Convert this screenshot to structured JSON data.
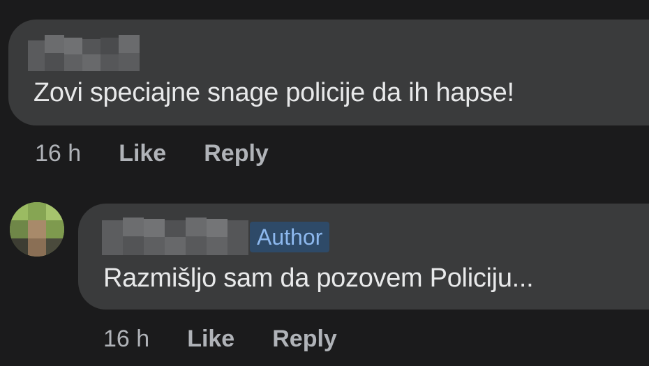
{
  "colors": {
    "background": "#1b1b1c",
    "bubble": "#3a3b3c",
    "text": "#e8e9ea",
    "meta": "#b0b3b8",
    "author_badge_bg": "#2e4a68",
    "author_badge_text": "#8db8ee"
  },
  "comment": {
    "author_name": "",
    "author_name_state": "pixelated",
    "text": "Zovi speciajne snage policije da ih hapse!",
    "timestamp": "16 h",
    "like_label": "Like",
    "reply_label": "Reply"
  },
  "reply": {
    "author_name": "",
    "author_name_state": "pixelated",
    "avatar_state": "pixelated",
    "badge": "Author",
    "text": "Razmišljo sam da pozovem Policiju...",
    "timestamp": "16 h",
    "like_label": "Like",
    "reply_label": "Reply"
  }
}
